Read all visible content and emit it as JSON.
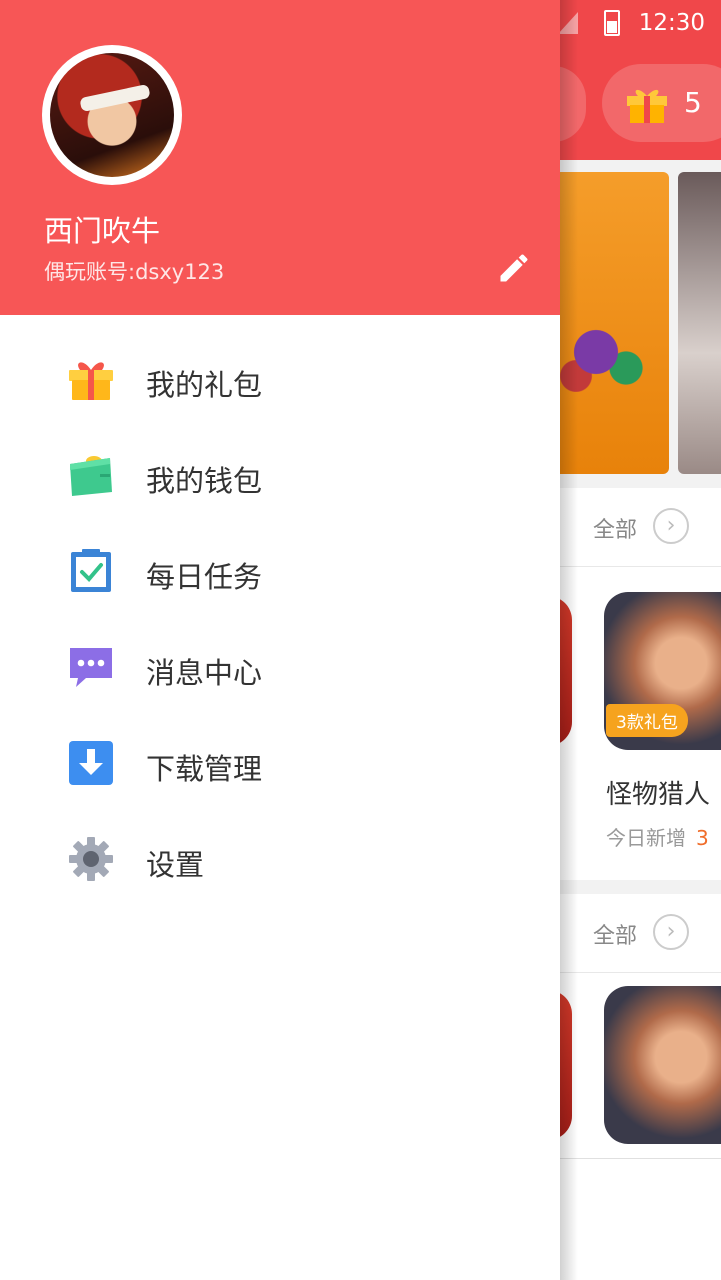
{
  "drawer": {
    "user": {
      "name": "西门吹牛",
      "account": "偶玩账号:dsxy123"
    },
    "menu": [
      {
        "label": "我的礼包",
        "icon": "gift-icon"
      },
      {
        "label": "我的钱包",
        "icon": "wallet-icon"
      },
      {
        "label": "每日任务",
        "icon": "clipboard-check-icon"
      },
      {
        "label": "消息中心",
        "icon": "chat-bubble-icon"
      },
      {
        "label": "下载管理",
        "icon": "download-icon"
      },
      {
        "label": "设置",
        "icon": "gear-icon"
      }
    ]
  },
  "status_bar": {
    "time": "12:30"
  },
  "background": {
    "gift_count": "5",
    "sections": [
      {
        "all_label": "全部"
      },
      {
        "all_label": "全部"
      }
    ],
    "game": {
      "badge": "3款礼包",
      "name": "怪物猎人",
      "sub_label": "今日新增",
      "sub_value": "3"
    }
  },
  "colors": {
    "drawer_header": "#f75656",
    "app_header": "#f0474a",
    "badge_orange": "#f6a31e"
  }
}
